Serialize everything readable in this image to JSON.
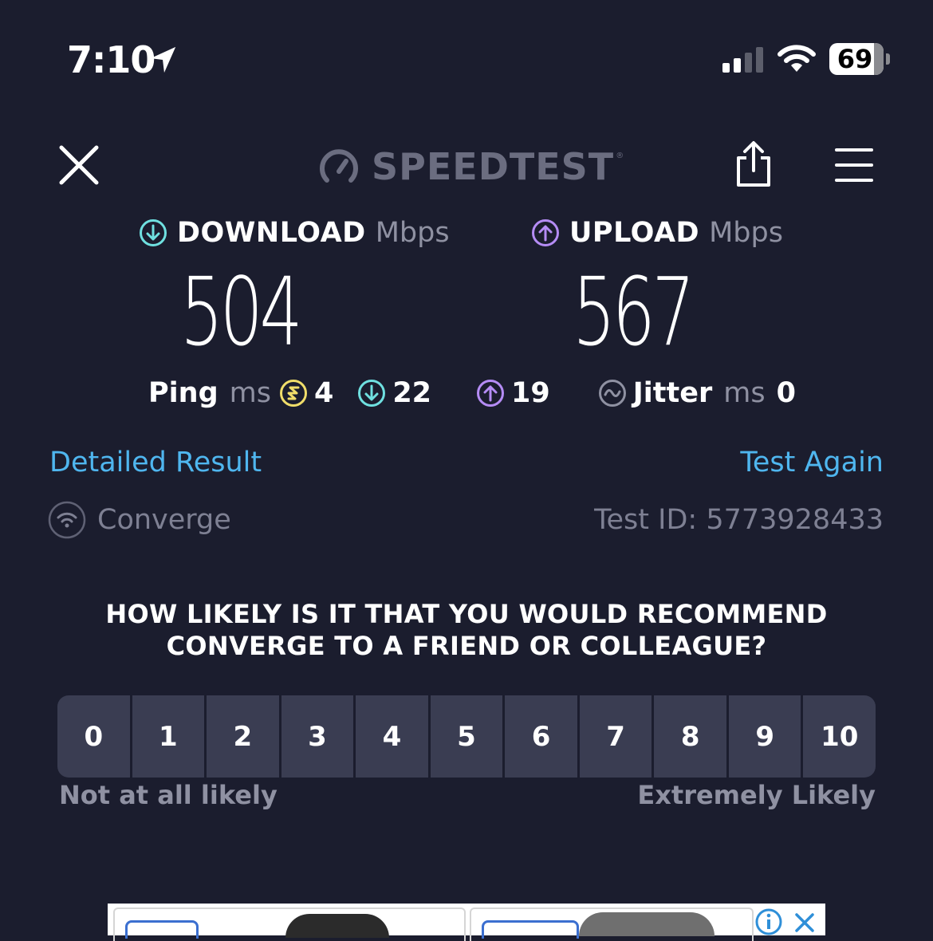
{
  "status_bar": {
    "time": "7:10",
    "battery": "69",
    "icons": [
      "location-arrow-icon",
      "cellular-signal-icon",
      "wifi-icon",
      "battery-icon"
    ]
  },
  "header": {
    "brand": "SPEEDTEST",
    "trademark": "®",
    "icons": [
      "close-icon",
      "speedometer-icon",
      "share-icon",
      "menu-icon"
    ]
  },
  "download": {
    "label": "DOWNLOAD",
    "unit": "Mbps",
    "value": "504",
    "color": "#6fe0e0"
  },
  "upload": {
    "label": "UPLOAD",
    "unit": "Mbps",
    "value": "567",
    "color": "#b58cf5"
  },
  "latency": {
    "ping_label": "Ping",
    "ping_unit": "ms",
    "ping_idle": "4",
    "ping_download": "22",
    "ping_upload": "19",
    "jitter_label": "Jitter",
    "jitter_unit": "ms",
    "jitter": "0",
    "idle_color": "#f0dd6a"
  },
  "links": {
    "detailed_result": "Detailed Result",
    "test_again": "Test Again",
    "link_color": "#4fb6ef"
  },
  "provider": {
    "name": "Converge",
    "test_id": "Test ID: 5773928433"
  },
  "survey": {
    "question": "HOW LIKELY IS IT THAT YOU WOULD RECOMMEND CONVERGE TO A FRIEND OR COLLEAGUE?",
    "options": [
      "0",
      "1",
      "2",
      "3",
      "4",
      "5",
      "6",
      "7",
      "8",
      "9",
      "10"
    ],
    "low_label": "Not at all likely",
    "high_label": "Extremely Likely"
  },
  "theme": {
    "background": "#1b1d2e",
    "scale_button": "#3a3d52"
  }
}
